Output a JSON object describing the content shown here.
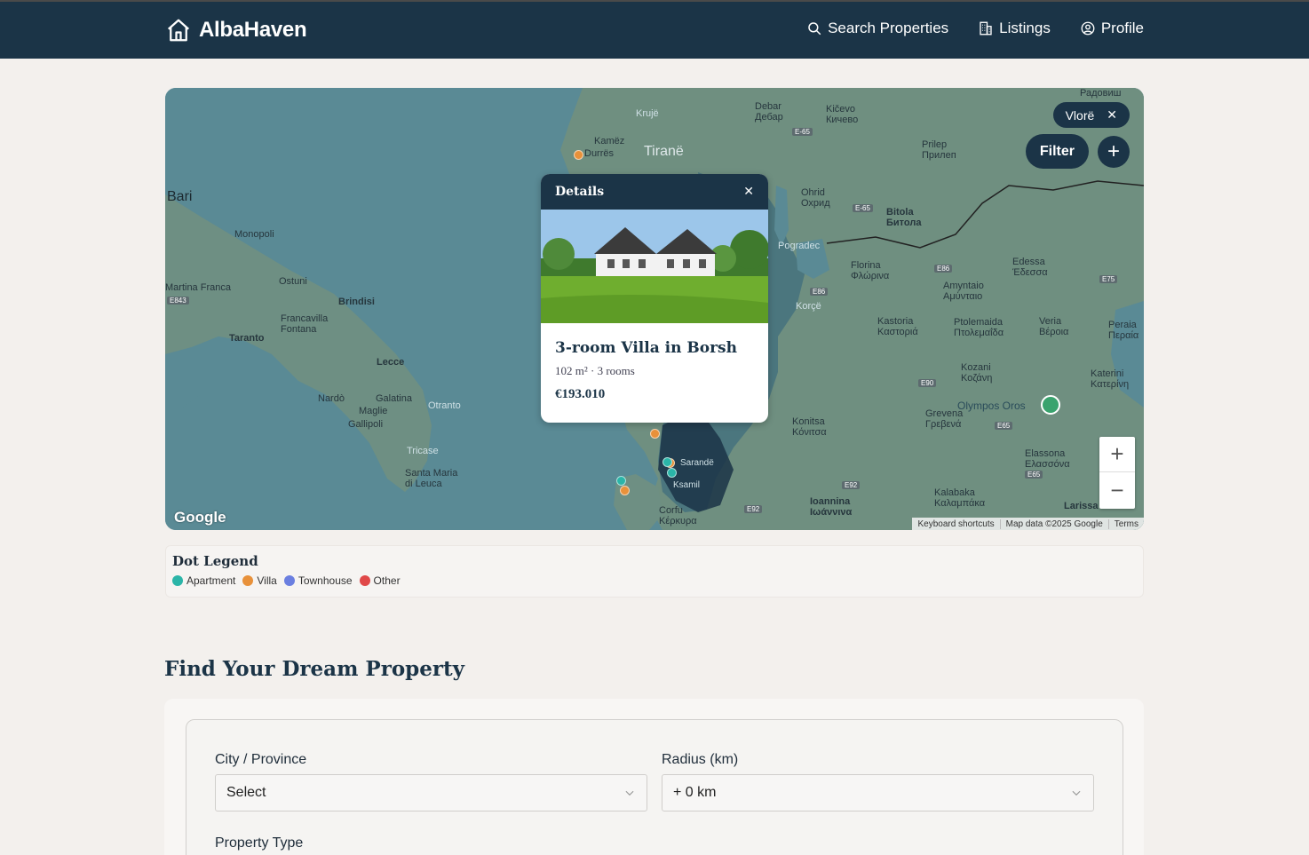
{
  "brand": {
    "name": "AlbaHaven",
    "icon": "home-icon"
  },
  "nav": [
    {
      "label": "Search Properties",
      "icon": "search-icon"
    },
    {
      "label": "Listings",
      "icon": "building-icon"
    },
    {
      "label": "Profile",
      "icon": "user-circle-icon"
    }
  ],
  "map": {
    "active_filter_chip": "Vlorë",
    "filter_button": "Filter",
    "google_logo": "Google",
    "attribution": [
      "Keyboard shortcuts",
      "Map data ©2025 Google",
      "Terms"
    ],
    "places": {
      "bari": "Bari",
      "monopoli": "Monopoli",
      "ostuni": "Ostuni",
      "martina_franca": "Martina Franca",
      "brindisi": "Brindisi",
      "francavilla": "Francavilla\nFontana",
      "taranto": "Taranto",
      "lecce": "Lecce",
      "nardo": "Nardò",
      "galatina": "Galatina",
      "maglie": "Maglie",
      "gallipoli": "Gallipoli",
      "otranto": "Otranto",
      "tricase": "Tricase",
      "santa_maria": "Santa Maria\ndi Leuca",
      "kruje": "Krujë",
      "kamez": "Kamëz",
      "durres": "Durrës",
      "tirane": "Tiranë",
      "debar": "Debar\nДебар",
      "kicevo": "Kičevo\nКичево",
      "radovish": "Радовиш",
      "prilep": "Prilep\nПрилеп",
      "ohrid": "Ohrid\nОхрид",
      "bitola": "Bitola\nБитола",
      "pogradec": "Pogradec",
      "florina": "Florina\nΦλώρινα",
      "edessa": "Edessa\nΈδεσσα",
      "amyntaio": "Amyntaio\nΑμύνταιο",
      "korce": "Korçë",
      "kastoria": "Kastoria\nΚαστοριά",
      "ptolemaida": "Ptolemaida\nΠτολεμαΐδα",
      "veria": "Veria\nΒέροια",
      "peraia": "Peraia\nΠεραία",
      "kozani": "Kozani\nΚοζάνη",
      "katerini": "Katerini\nΚατερίνη",
      "olympos": "Olympos Oros",
      "grevena": "Grevena\nΓρεβενά",
      "konitsa": "Konitsa\nΚόνιτσα",
      "elassona": "Elassona\nΕλασσόνα",
      "kalabaka": "Kalabaka\nΚαλαμπάκα",
      "ioannina": "Ioannina\nΙωάννινα",
      "corfu": "Corfu\nΚέρκυρα",
      "larissa": "Larissa",
      "sarande": "Sarandë",
      "ksamil": "Ksamil"
    },
    "roads": [
      "E843",
      "E-65",
      "E-65",
      "E86",
      "E86",
      "E86",
      "E75",
      "E90",
      "E65",
      "E65",
      "E92",
      "E92"
    ],
    "dots_colors": {
      "apartment": "#2bb5a8",
      "villa": "#e8913a",
      "townhouse": "#6b7fe0",
      "other": "#e04848"
    }
  },
  "popup": {
    "header": "Details",
    "title": "3-room Villa in Borsh",
    "meta": "102 m² · 3 rooms",
    "price": "€193.010"
  },
  "legend": {
    "title": "Dot Legend",
    "items": [
      {
        "label": "Apartment",
        "color": "#2bb5a8"
      },
      {
        "label": "Villa",
        "color": "#e8913a"
      },
      {
        "label": "Townhouse",
        "color": "#6b7fe0"
      },
      {
        "label": "Other",
        "color": "#e04848"
      }
    ]
  },
  "search": {
    "title": "Find Your Dream Property",
    "city_label": "City / Province",
    "city_value": "Select",
    "radius_label": "Radius (km)",
    "radius_value": "+ 0 km",
    "property_type_label": "Property Type"
  },
  "colors": {
    "header_bg": "#1b3447",
    "page_bg": "#f3f0ed",
    "sea": "#5a8a95",
    "land": "#6e8f83"
  }
}
